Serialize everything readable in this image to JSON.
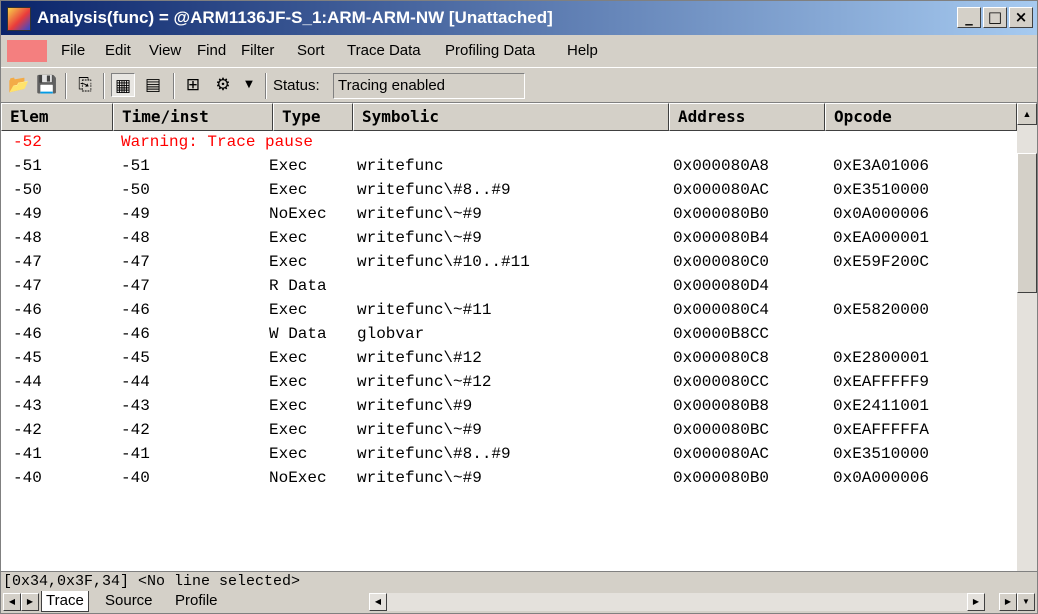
{
  "window": {
    "title": "Analysis(func) = @ARM1136JF-S_1:ARM-ARM-NW [Unattached]"
  },
  "menu": [
    "File",
    "Edit",
    "View",
    "Find",
    "Filter",
    "Sort",
    "Trace Data",
    "Profiling Data",
    "Help"
  ],
  "toolbar": {
    "status_label": "Status:",
    "status_value": "Tracing enabled"
  },
  "columns": [
    "Elem",
    "Time/inst",
    "Type",
    "Symbolic",
    "Address",
    "Opcode"
  ],
  "rows": [
    {
      "elem": "-52",
      "time": "Warning: Trace pause",
      "type": "",
      "symbolic": "",
      "address": "",
      "opcode": "",
      "warning": true
    },
    {
      "elem": "-51",
      "time": "-51",
      "type": "Exec",
      "symbolic": "writefunc",
      "address": "0x000080A8",
      "opcode": "0xE3A01006"
    },
    {
      "elem": "-50",
      "time": "-50",
      "type": "Exec",
      "symbolic": "writefunc\\#8..#9",
      "address": "0x000080AC",
      "opcode": "0xE3510000"
    },
    {
      "elem": "-49",
      "time": "-49",
      "type": "NoExec",
      "symbolic": "writefunc\\~#9",
      "address": "0x000080B0",
      "opcode": "0x0A000006"
    },
    {
      "elem": "-48",
      "time": "-48",
      "type": "Exec",
      "symbolic": "writefunc\\~#9",
      "address": "0x000080B4",
      "opcode": "0xEA000001"
    },
    {
      "elem": "-47",
      "time": "-47",
      "type": "Exec",
      "symbolic": "writefunc\\#10..#11",
      "address": "0x000080C0",
      "opcode": "0xE59F200C"
    },
    {
      "elem": "-47",
      "time": "-47",
      "type": "R Data",
      "symbolic": "",
      "address": "0x000080D4",
      "opcode": ""
    },
    {
      "elem": "-46",
      "time": "-46",
      "type": "Exec",
      "symbolic": "writefunc\\~#11",
      "address": "0x000080C4",
      "opcode": "0xE5820000"
    },
    {
      "elem": "-46",
      "time": "-46",
      "type": "W Data",
      "symbolic": "globvar",
      "address": "0x0000B8CC",
      "opcode": ""
    },
    {
      "elem": "-45",
      "time": "-45",
      "type": "Exec",
      "symbolic": "writefunc\\#12",
      "address": "0x000080C8",
      "opcode": "0xE2800001"
    },
    {
      "elem": "-44",
      "time": "-44",
      "type": "Exec",
      "symbolic": "writefunc\\~#12",
      "address": "0x000080CC",
      "opcode": "0xEAFFFFF9"
    },
    {
      "elem": "-43",
      "time": "-43",
      "type": "Exec",
      "symbolic": "writefunc\\#9",
      "address": "0x000080B8",
      "opcode": "0xE2411001"
    },
    {
      "elem": "-42",
      "time": "-42",
      "type": "Exec",
      "symbolic": "writefunc\\~#9",
      "address": "0x000080BC",
      "opcode": "0xEAFFFFFA"
    },
    {
      "elem": "-41",
      "time": "-41",
      "type": "Exec",
      "symbolic": "writefunc\\#8..#9",
      "address": "0x000080AC",
      "opcode": "0xE3510000"
    },
    {
      "elem": "-40",
      "time": "-40",
      "type": "NoExec",
      "symbolic": "writefunc\\~#9",
      "address": "0x000080B0",
      "opcode": "0x0A000006"
    }
  ],
  "status_line": "[0x34,0x3F,34] <No line selected>",
  "tabs": [
    "Trace",
    "Source",
    "Profile"
  ],
  "colors": {
    "warning": "#ff0000",
    "title_start": "#0a246a",
    "title_end": "#a6caf0"
  }
}
